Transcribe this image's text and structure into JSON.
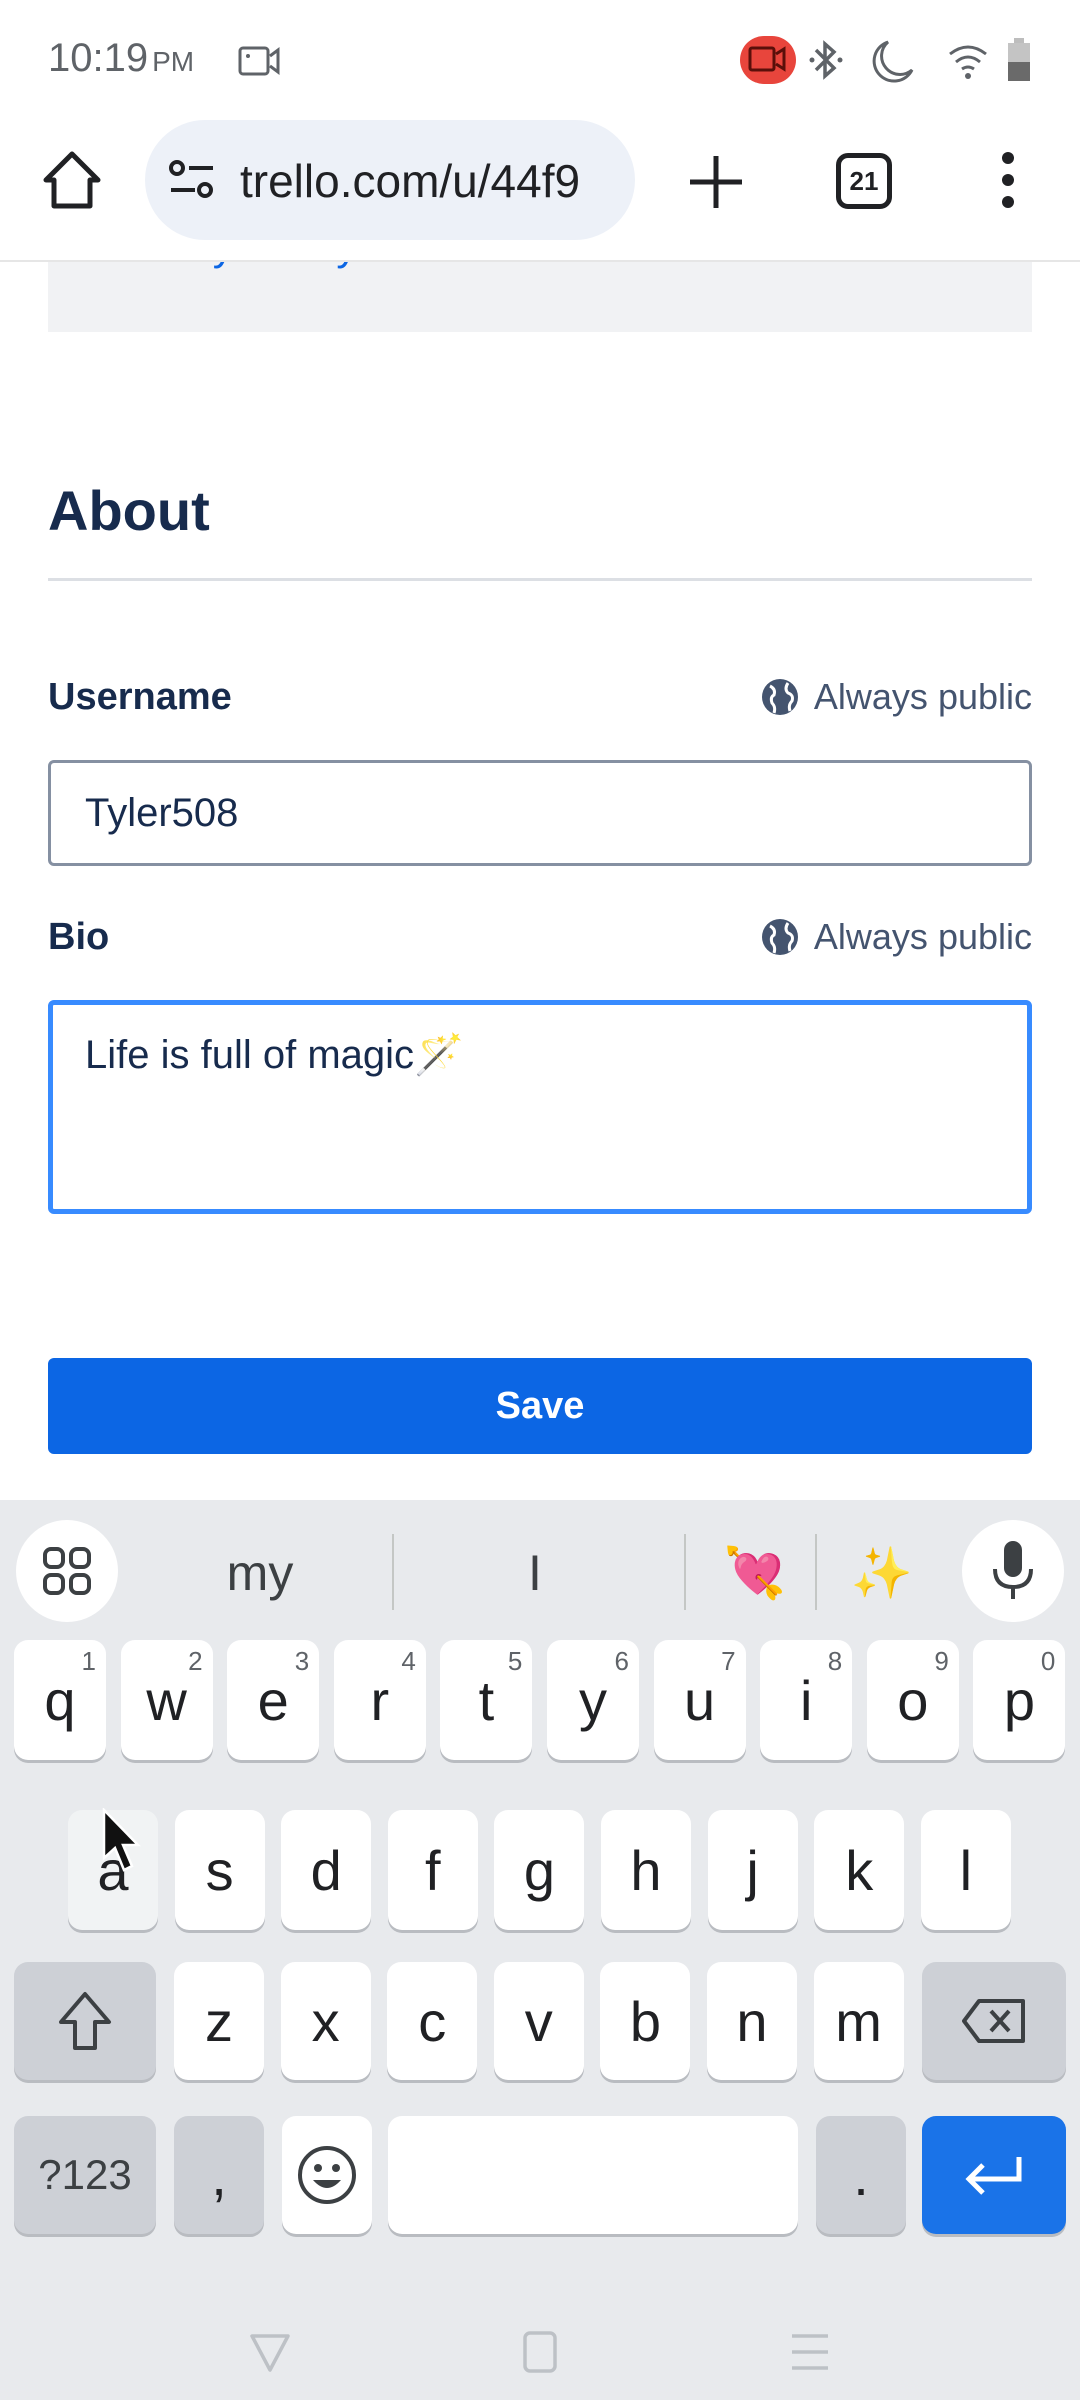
{
  "status_bar": {
    "time": "10:19",
    "ampm": "PM",
    "icons": [
      "screen-record-icon",
      "bluetooth-icon",
      "do-not-disturb-icon",
      "wifi-icon",
      "battery-icon"
    ],
    "record_color": "#e8453c"
  },
  "browser": {
    "url": "trello.com/u/44f9",
    "tab_count": "21",
    "icons": [
      "home-icon",
      "site-settings-icon",
      "new-tab-icon",
      "tabs-icon",
      "more-menu-icon"
    ]
  },
  "page": {
    "privacy_link": "Privacy Policy.",
    "about_heading": "About",
    "username": {
      "label": "Username",
      "visibility": "Always public",
      "value": "Tyler508"
    },
    "bio": {
      "label": "Bio",
      "visibility": "Always public",
      "value": "Life is full of magic🪄"
    },
    "save_label": "Save",
    "accent_color": "#0c66e4"
  },
  "keyboard": {
    "suggestions": [
      "my",
      "I",
      "💘",
      "✨"
    ],
    "row1": [
      {
        "key": "q",
        "hint": "1"
      },
      {
        "key": "w",
        "hint": "2"
      },
      {
        "key": "e",
        "hint": "3"
      },
      {
        "key": "r",
        "hint": "4"
      },
      {
        "key": "t",
        "hint": "5"
      },
      {
        "key": "y",
        "hint": "6"
      },
      {
        "key": "u",
        "hint": "7"
      },
      {
        "key": "i",
        "hint": "8"
      },
      {
        "key": "o",
        "hint": "9"
      },
      {
        "key": "p",
        "hint": "0"
      }
    ],
    "row2": [
      "a",
      "s",
      "d",
      "f",
      "g",
      "h",
      "j",
      "k",
      "l"
    ],
    "row3": [
      "z",
      "x",
      "c",
      "v",
      "b",
      "n",
      "m"
    ],
    "symbols_label": "?123",
    "comma": ",",
    "period": ".",
    "enter_color": "#1a73e8"
  },
  "nav_bar": {
    "icons": [
      "back-icon",
      "home-icon",
      "recents-icon"
    ]
  }
}
